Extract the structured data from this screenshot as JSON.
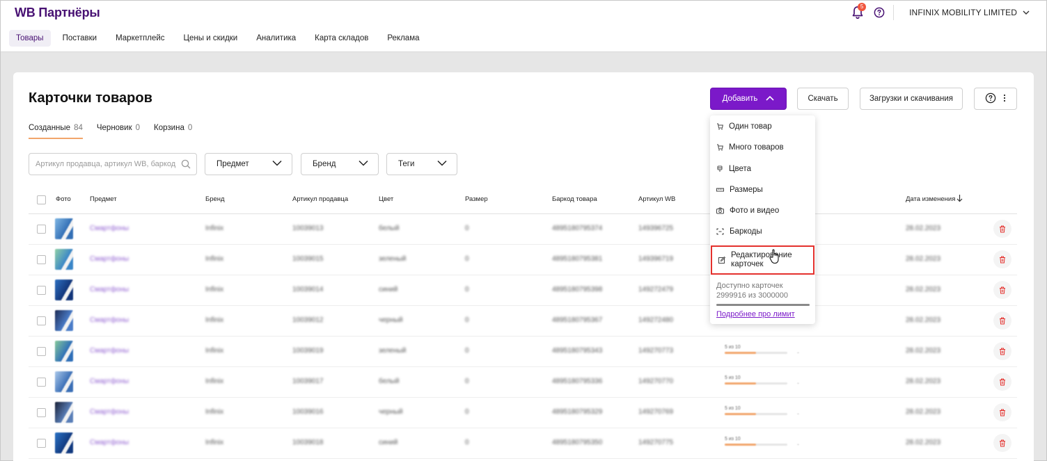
{
  "header": {
    "logo": "WB Партнёры",
    "notifications_count": "5",
    "company": "INFINIX MOBILITY LIMITED",
    "nav": [
      {
        "label": "Товары",
        "active": true
      },
      {
        "label": "Поставки"
      },
      {
        "label": "Маркетплейс"
      },
      {
        "label": "Цены и скидки"
      },
      {
        "label": "Аналитика"
      },
      {
        "label": "Карта складов"
      },
      {
        "label": "Реклама"
      }
    ]
  },
  "page": {
    "title": "Карточки товаров",
    "buttons": {
      "add": "Добавить",
      "download": "Скачать",
      "loads": "Загрузки и скачивания"
    },
    "tabs": [
      {
        "label": "Созданные",
        "count": "84",
        "active": true
      },
      {
        "label": "Черновик",
        "count": "0"
      },
      {
        "label": "Корзина",
        "count": "0"
      }
    ],
    "search_placeholder": "Артикул продавца, артикул WB, баркод",
    "filters": [
      "Предмет",
      "Бренд",
      "Теги"
    ]
  },
  "table": {
    "columns": [
      "Фото",
      "Предмет",
      "Бренд",
      "Артикул продавца",
      "Цвет",
      "Размер",
      "Баркод товара",
      "Артикул WB",
      "Дата изменения"
    ],
    "rows": [
      {
        "subject": "Смартфоны",
        "brand": "Infinix",
        "vendor_code": "10039013",
        "color": "белый",
        "size": "0",
        "barcode": "4895180795374",
        "wb_article": "149396725",
        "date": "28.02.2023",
        "rating": null
      },
      {
        "subject": "Смартфоны",
        "brand": "Infinix",
        "vendor_code": "10039015",
        "color": "зеленый",
        "size": "0",
        "barcode": "4895180795381",
        "wb_article": "149396719",
        "date": "28.02.2023",
        "rating": null
      },
      {
        "subject": "Смартфоны",
        "brand": "Infinix",
        "vendor_code": "10039014",
        "color": "синий",
        "size": "0",
        "barcode": "4895180795398",
        "wb_article": "149272479",
        "date": "28.02.2023",
        "rating": null
      },
      {
        "subject": "Смартфоны",
        "brand": "Infinix",
        "vendor_code": "10039012",
        "color": "черный",
        "size": "0",
        "barcode": "4895180795367",
        "wb_article": "149272480",
        "date": "28.02.2023",
        "rating": null
      },
      {
        "subject": "Смартфоны",
        "brand": "Infinix",
        "vendor_code": "10039019",
        "color": "зеленый",
        "size": "0",
        "barcode": "4895180795343",
        "wb_article": "149270773",
        "date": "28.02.2023",
        "rating": "5 из 10",
        "rating_value": 0.5
      },
      {
        "subject": "Смартфоны",
        "brand": "Infinix",
        "vendor_code": "10039017",
        "color": "белый",
        "size": "0",
        "barcode": "4895180795336",
        "wb_article": "149270770",
        "date": "28.02.2023",
        "rating": "5 из 10",
        "rating_value": 0.5
      },
      {
        "subject": "Смартфоны",
        "brand": "Infinix",
        "vendor_code": "10039016",
        "color": "черный",
        "size": "0",
        "barcode": "4895180795329",
        "wb_article": "149270769",
        "date": "28.02.2023",
        "rating": "5 из 10",
        "rating_value": 0.5
      },
      {
        "subject": "Смартфоны",
        "brand": "Infinix",
        "vendor_code": "10039018",
        "color": "синий",
        "size": "0",
        "barcode": "4895180795350",
        "wb_article": "149270775",
        "date": "28.02.2023",
        "rating": "5 из 10",
        "rating_value": 0.5
      }
    ]
  },
  "add_menu": {
    "items": [
      {
        "label": "Один товар",
        "icon": "box-icon"
      },
      {
        "label": "Много товаров",
        "icon": "boxes-icon"
      },
      {
        "label": "Цвета",
        "icon": "palette-icon"
      },
      {
        "label": "Размеры",
        "icon": "ruler-icon"
      },
      {
        "label": "Фото и видео",
        "icon": "camera-icon"
      },
      {
        "label": "Баркоды",
        "icon": "barcode-icon"
      }
    ],
    "edit_line1": "Редактирование",
    "edit_line2": "карточек",
    "quota_line1": "Доступно карточек",
    "quota_line2": "2999916 из 3000000",
    "quota_used_fraction": 0.99997,
    "limit_link": "Подробнее про лимит"
  },
  "colors": {
    "brand": "#481173",
    "accent": "#7b19c9",
    "tab_underline": "#f2a56b",
    "delete": "#e4312d",
    "highlight_border": "#e4312d"
  }
}
